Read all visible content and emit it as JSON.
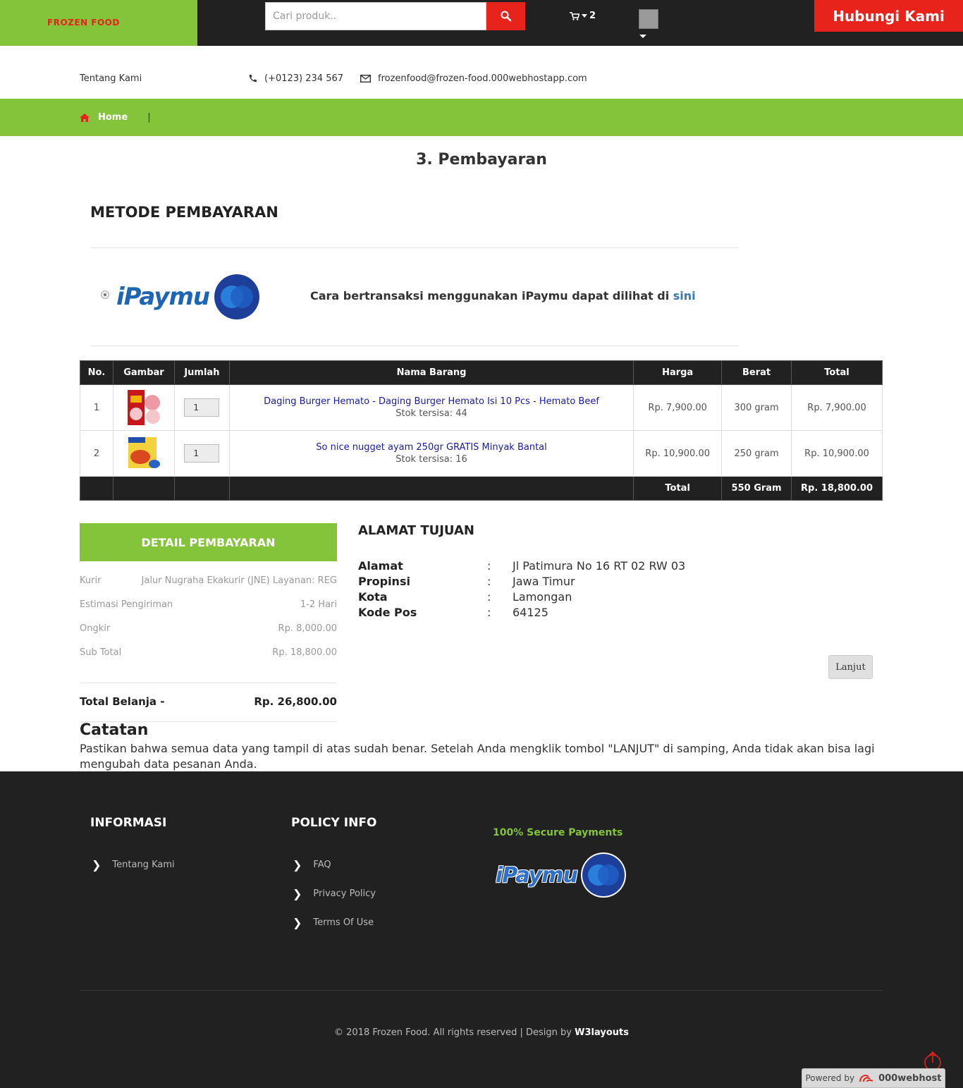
{
  "header": {
    "brand": "FROZEN FOOD",
    "search_placeholder": "Cari produk..",
    "cart_count": "2",
    "contact_button": "Hubungi Kami"
  },
  "info_bar": {
    "about": "Tentang Kami",
    "phone": "(+0123) 234 567",
    "email": "frozenfood@frozen-food.000webhostapp.com"
  },
  "breadcrumb": {
    "home": "Home",
    "separator": "|"
  },
  "page_title": "3. Pembayaran",
  "payment_method": {
    "title": "METODE PEMBAYARAN",
    "provider_logo_text": "iPaymu",
    "note_prefix": "Cara bertransaksi menggunakan iPaymu dapat dilihat di",
    "note_link": "sini"
  },
  "cart_table": {
    "headers": [
      "No.",
      "Gambar",
      "Jumlah",
      "Nama Barang",
      "Harga",
      "Berat",
      "Total"
    ],
    "rows": [
      {
        "no": "1",
        "qty": "1",
        "name": "Daging Burger Hemato - Daging Burger Hemato Isi 10 Pcs - Hemato Beef",
        "stock": "Stok tersisa: 44",
        "price": "Rp. 7,900.00",
        "weight": "300 gram",
        "total": "Rp. 7,900.00"
      },
      {
        "no": "2",
        "qty": "1",
        "name": "So nice nugget ayam 250gr GRATIS Minyak Bantal",
        "stock": "Stok tersisa: 16",
        "price": "Rp. 10,900.00",
        "weight": "250 gram",
        "total": "Rp. 10,900.00"
      }
    ],
    "footer": {
      "label": "Total",
      "weight": "550 Gram",
      "total": "Rp. 18,800.00"
    }
  },
  "payment_detail": {
    "title": "DETAIL PEMBAYARAN",
    "rows": [
      {
        "label": "Kurir",
        "value": "Jalur Nugraha Ekakurir (JNE) Layanan: REG"
      },
      {
        "label": "Estimasi Pengiriman",
        "value": "1-2 Hari"
      },
      {
        "label": "Ongkir",
        "value": "Rp. 8,000.00"
      },
      {
        "label": "Sub Total",
        "value": "Rp. 18,800.00"
      }
    ],
    "grand_label": "Total Belanja -",
    "grand_value": "Rp. 26,800.00"
  },
  "address": {
    "title": "ALAMAT TUJUAN",
    "colon": ":",
    "rows": [
      {
        "label": "Alamat",
        "value": "Jl Patimura No 16 RT 02 RW 03"
      },
      {
        "label": "Propinsi",
        "value": "Jawa Timur"
      },
      {
        "label": "Kota",
        "value": "Lamongan"
      },
      {
        "label": "Kode Pos",
        "value": "64125"
      }
    ]
  },
  "continue_button": "Lanjut",
  "note": {
    "title": "Catatan",
    "text": "Pastikan bahwa semua data yang tampil di atas sudah benar. Setelah Anda mengklik tombol \"LANJUT\" di samping, Anda tidak akan bisa lagi mengubah data pesanan Anda."
  },
  "footer": {
    "info_title": "INFORMASI",
    "info_links": [
      "Tentang Kami"
    ],
    "policy_title": "POLICY INFO",
    "policy_links": [
      "FAQ",
      "Privacy Policy",
      "Terms Of Use"
    ],
    "secure_title": "100% Secure Payments",
    "secure_logo_text": "iPaymu",
    "copyright": "© 2018 Frozen Food. All rights reserved | Design by",
    "designer": "W3layouts",
    "powered_label": "Powered by",
    "powered_brand": "000webhost"
  },
  "colors": {
    "green": "#84c43a",
    "red": "#e8231b",
    "dark": "#212121",
    "link": "#1a1aa6"
  }
}
